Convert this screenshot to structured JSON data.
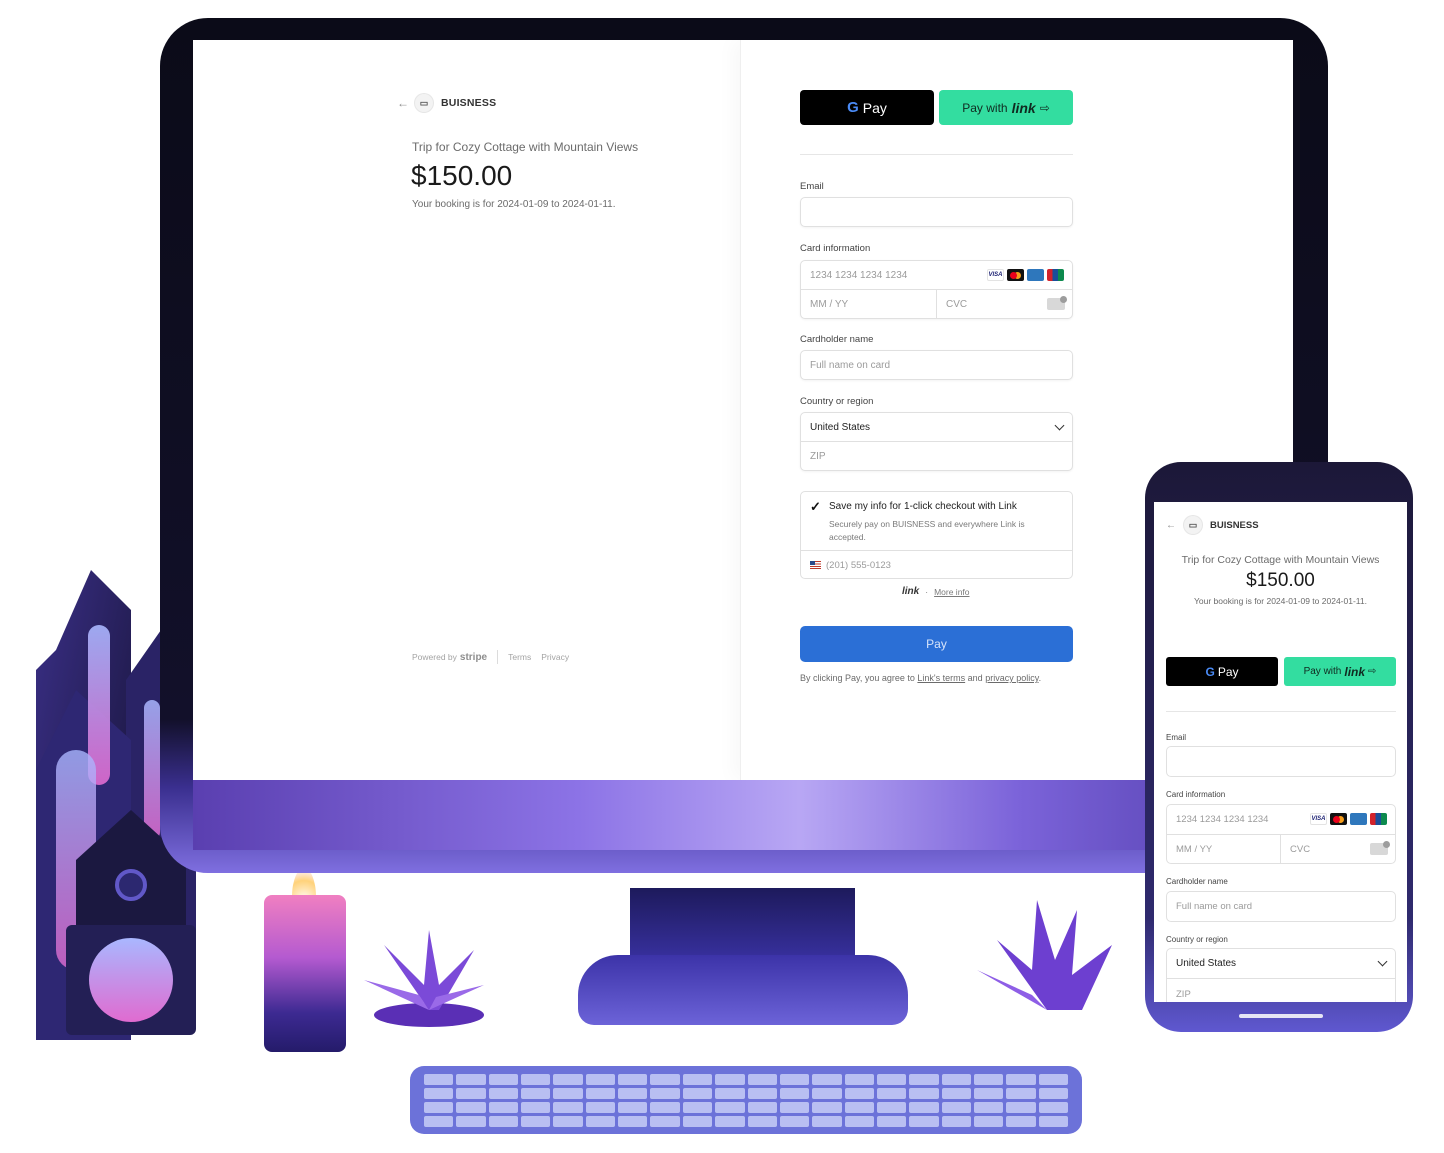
{
  "merchant": {
    "name": "BUISNESS"
  },
  "order": {
    "product": "Trip for Cozy Cottage with Mountain Views",
    "price": "$150.00",
    "booking_note": "Your booking is for 2024-01-09 to 2024-01-11."
  },
  "left_footer": {
    "powered_by": "Powered by",
    "brand": "stripe",
    "terms": "Terms",
    "privacy": "Privacy"
  },
  "wallets": {
    "gpay_label": "Pay",
    "link_prefix": "Pay with",
    "link_word": "link",
    "link_arrow": "⇨"
  },
  "form": {
    "email_label": "Email",
    "email_value": "",
    "card_label": "Card information",
    "card_number_placeholder": "1234 1234 1234 1234",
    "expiry_placeholder": "MM / YY",
    "cvc_placeholder": "CVC",
    "cardholder_label": "Cardholder name",
    "cardholder_placeholder": "Full name on card",
    "country_label": "Country or region",
    "country_value": "United States",
    "zip_placeholder": "ZIP"
  },
  "card_brands": [
    "VISA",
    "",
    "",
    ""
  ],
  "link_save": {
    "checked": true,
    "title": "Save my info for 1-click checkout with Link",
    "description": "Securely pay on BUISNESS and everywhere Link is accepted.",
    "phone_placeholder": "(201) 555-0123",
    "footer_logo": "link",
    "footer_sep": "·",
    "more_info": "More info"
  },
  "pay_button": "Pay",
  "terms": {
    "prefix": "By clicking Pay, you agree to",
    "link_terms": "Link's terms",
    "and": "and",
    "privacy": "privacy policy",
    "end": "."
  },
  "colors": {
    "link_green": "#33dda0",
    "pay_blue": "#2b6fd6",
    "device_purple": "#3b33a6"
  }
}
